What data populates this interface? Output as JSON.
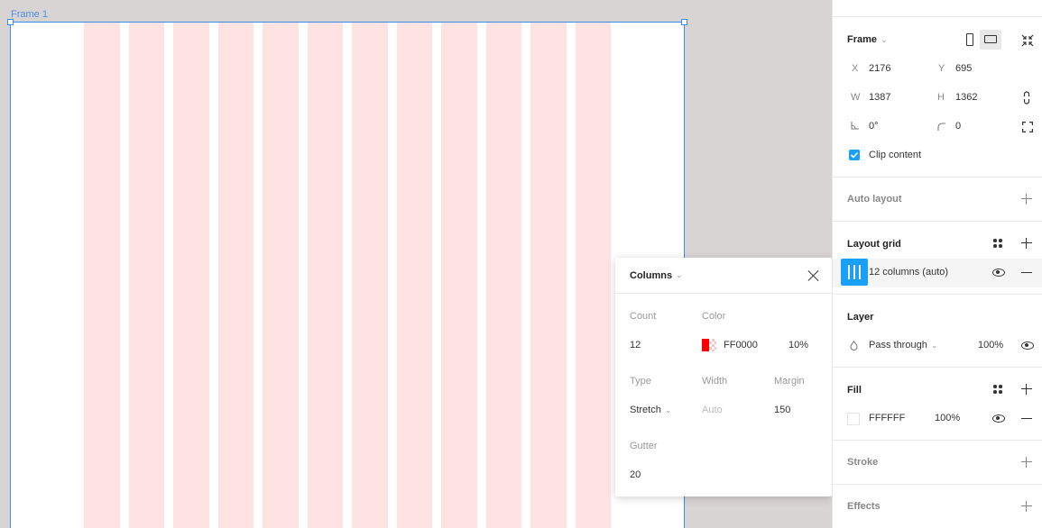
{
  "canvas": {
    "frame_label": "Frame 1",
    "column_count": 12
  },
  "popup": {
    "title": "Columns",
    "count_label": "Count",
    "count_value": "12",
    "color_label": "Color",
    "color_hex": "FF0000",
    "color_opacity": "10%",
    "type_label": "Type",
    "type_value": "Stretch",
    "width_label": "Width",
    "width_placeholder": "Auto",
    "margin_label": "Margin",
    "margin_value": "150",
    "gutter_label": "Gutter",
    "gutter_value": "20"
  },
  "panel": {
    "frame": {
      "title": "Frame",
      "x_label": "X",
      "x_value": "2176",
      "y_label": "Y",
      "y_value": "695",
      "w_label": "W",
      "w_value": "1387",
      "h_label": "H",
      "h_value": "1362",
      "rotation_value": "0°",
      "radius_value": "0",
      "clip_label": "Clip content"
    },
    "auto_layout": {
      "title": "Auto layout"
    },
    "layout_grid": {
      "title": "Layout grid",
      "item_label": "12 columns (auto)"
    },
    "layer": {
      "title": "Layer",
      "blend": "Pass through",
      "opacity": "100%"
    },
    "fill": {
      "title": "Fill",
      "hex": "FFFFFF",
      "opacity": "100%"
    },
    "stroke": {
      "title": "Stroke"
    },
    "effects": {
      "title": "Effects"
    }
  },
  "colors": {
    "accent": "#18a0fb",
    "selection": "#3d8be8",
    "grid_column": "#ffe3e3",
    "grid_color": "#ff0000",
    "canvas_bg": "#d9d4d4"
  }
}
